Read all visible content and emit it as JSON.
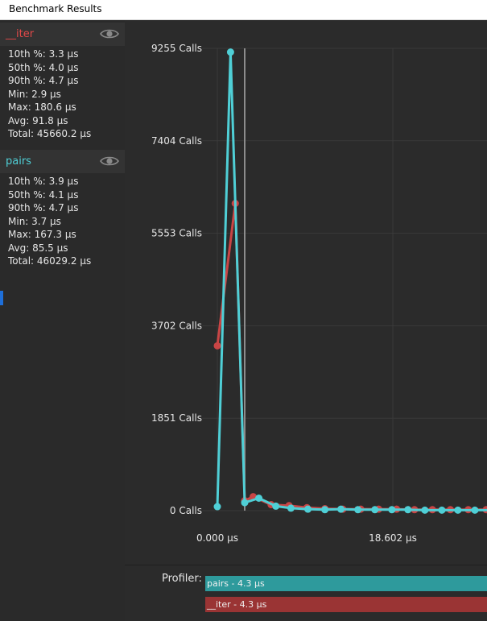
{
  "window": {
    "title": "Benchmark Results"
  },
  "sidebar": {
    "series": [
      {
        "name": "__iter",
        "color": "#e04848",
        "eye_icon": "eye-icon",
        "stats": [
          "10th %: 3.3 µs",
          "50th %: 4.0 µs",
          "90th %: 4.7 µs",
          "Min: 2.9 µs",
          "Max: 180.6 µs",
          "Avg: 91.8 µs",
          "Total: 45660.2 µs"
        ]
      },
      {
        "name": "pairs",
        "color": "#4fcfd6",
        "eye_icon": "eye-icon",
        "stats": [
          "10th %: 3.9 µs",
          "50th %: 4.1 µs",
          "90th %: 4.7 µs",
          "Min: 3.7 µs",
          "Max: 167.3 µs",
          "Avg: 85.5 µs",
          "Total: 46029.2 µs"
        ]
      }
    ]
  },
  "chart_data": {
    "type": "line",
    "y_ticks": [
      "0 Calls",
      "1851 Calls",
      "3702 Calls",
      "5553 Calls",
      "7404 Calls",
      "9255 Calls"
    ],
    "y_tick_values": [
      0,
      1851,
      3702,
      5553,
      7404,
      9255
    ],
    "x_ticks": [
      "0.000 µs",
      "18.602 µs"
    ],
    "x_tick_values": [
      0,
      18.602
    ],
    "ylim": [
      0,
      9255
    ],
    "xlim": [
      -1.6,
      34.5
    ],
    "grid": true,
    "marker_x": 2.9,
    "series": [
      {
        "name": "__iter",
        "color": "#c94545",
        "x": [
          0.0,
          1.9,
          2.9,
          3.8,
          5.7,
          7.6,
          9.5,
          11.4,
          13.3,
          15.2,
          17.1,
          19.0,
          20.9,
          22.8,
          24.7,
          26.6,
          28.5,
          30.4,
          32.3,
          34.2
        ],
        "y": [
          3300,
          6150,
          200,
          280,
          120,
          100,
          60,
          40,
          30,
          30,
          30,
          30,
          20,
          20,
          20,
          20,
          20,
          20,
          20,
          20
        ]
      },
      {
        "name": "pairs",
        "color": "#4fcfd6",
        "x": [
          0.0,
          1.4,
          2.9,
          4.4,
          6.2,
          7.8,
          9.6,
          11.4,
          13.1,
          14.9,
          16.7,
          18.5,
          20.2,
          22.0,
          23.8,
          25.5,
          27.3,
          29.1,
          30.9,
          32.6,
          34.4
        ],
        "y": [
          80,
          9180,
          160,
          250,
          90,
          50,
          30,
          20,
          30,
          20,
          20,
          20,
          20,
          10,
          10,
          10,
          10,
          10,
          10,
          10,
          10
        ]
      }
    ]
  },
  "profiler": {
    "label": "Profiler:",
    "bars": [
      {
        "label": "pairs - 4.3 µs",
        "color": "#2e9a9c"
      },
      {
        "label": "__iter - 4.3 µs",
        "color": "#9a3434"
      }
    ]
  }
}
